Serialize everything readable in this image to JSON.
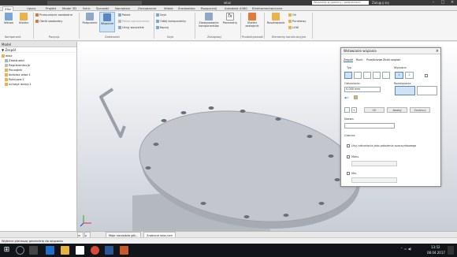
{
  "titlebar": {
    "document": "wlaz",
    "search_placeholder": "Wyszukaj w pomocy i poleceniach",
    "user": "Zaloguj się"
  },
  "tabs": [
    "Złóż",
    "Uporz.",
    "Projekt",
    "Model 3D",
    "Szkic",
    "Sprawdź",
    "Narzędzia",
    "Zarządzanie",
    "Widok",
    "Środowiska",
    "Rozpocznij",
    "Autodesk A360",
    "Elektromechaniczne"
  ],
  "ribbon": {
    "wstaw": "Wstaw",
    "utworz": "Utwórz",
    "przesun": "Przesunięcie swobodne",
    "obroc": "Obrót swobodny",
    "polaczenie": "Połączenie",
    "wiazanie": "Wiązanie",
    "pokaz": "Pokaż",
    "pokaz_ograniczenia": "Pokaż ograniczenia",
    "ukryj": "Ukryj wszystkie",
    "szyk": "Szyk",
    "odbij": "Odbij komponenty",
    "kopiuj": "Kopiuj",
    "zastepowanie": "Zastępowanie komponentów",
    "parametry": "Parametry",
    "utworz_zastepnik": "Utwórz zastępnik",
    "ruszt": "Rusztowanie",
    "os": "Oś",
    "punktowy": "Punktowy",
    "ucs": "LUW",
    "groups": [
      "Komponent",
      "Pozycja",
      "Zależności",
      "Szyk",
      "Zarządzaj",
      "Produktywność",
      "Elementy konstrukcyjne"
    ]
  },
  "sidebar": {
    "header": "Model",
    "tool": "Zespół",
    "tree": [
      "wlaz",
      "Zależności",
      "Reprezentacje",
      "Początek",
      "dolnasz wlaz:1",
      "Pokrywa:1",
      "uchwyt dolny:1"
    ]
  },
  "dialog": {
    "title": "Wstawianie wiązania",
    "tabs": [
      "Zespół",
      "Ruch",
      "Przejściowe",
      "Zbiór wiązań"
    ],
    "typ_label": "Typ",
    "wybrane_label": "Wybrane",
    "odsuniecie_label": "Odsunięcie:",
    "odsuniecie_value": "0,000 mm",
    "rozwiazanie_label": "Rozwiązanie",
    "ok": "OK",
    "anuluj": "Anuluj",
    "zastosuj": "Zastosuj",
    "nazwa_label": "Nazwa",
    "granice_label": "Granice",
    "uzyj_label": "Użyj odsunięcia jako położenia spoczynkowego",
    "maks_label": "Maks.",
    "min_label": "Min."
  },
  "doc_tabs": [
    "Moje narzędzia głó...",
    "Zrobione wlaz.iam"
  ],
  "status_text": "Wybierz pierwszą geometrię do wiązania",
  "taskbar": {
    "time": "13:52",
    "date": "08.04.2017"
  },
  "colors": {
    "accent": "#2a7bd0",
    "ribbon_bg": "#f5f5f5",
    "taskbar": "#111418"
  }
}
